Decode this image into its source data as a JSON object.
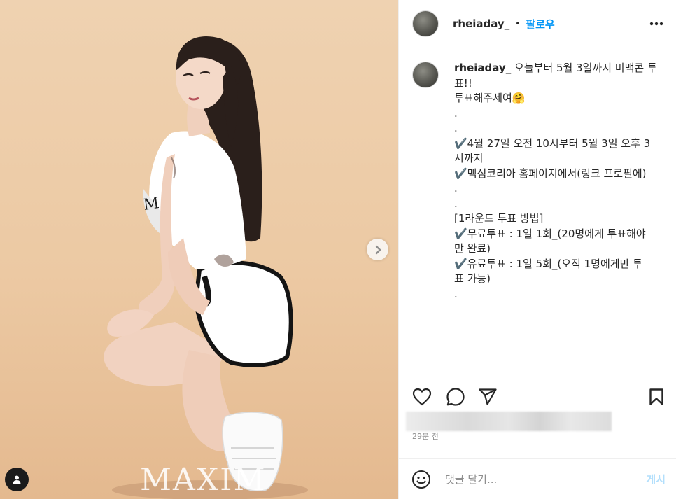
{
  "post": {
    "username": "rheiaday_",
    "dot": "•",
    "follow_label": "팔로우",
    "caption": " 오늘부터 5월 3일까지 미맥콘 투표!!\n투표해주세여🤗\n.\n.\n✔️4월 27일 오전 10시부터 5월 3일 오후 3\n시까지\n✔️맥심코리아 홈페이지에서(링크 프로필에)\n.\n.\n[1라운드 투표 방법]\n✔️무료투표 : 1일 1회_(20명에게 투표해야\n만 완료)\n✔️유료투표 : 1일 5회_(오직 1명에게만 투\n표 가능)\n.",
    "timestamp": "29분 전"
  },
  "media": {
    "watermark": "MAXIM",
    "bg_color": "#ecc9a3"
  },
  "icons": {
    "more": "more-horizontal-icon",
    "like": "heart-icon",
    "comment": "comment-bubble-icon",
    "share": "paper-plane-icon",
    "save": "bookmark-icon",
    "emoji": "emoji-smile-icon",
    "next": "chevron-right-icon",
    "tags": "user-tag-icon"
  },
  "comment_box": {
    "placeholder": "댓글 달기...",
    "post_label": "게시"
  },
  "colors": {
    "accent": "#0095f6",
    "post_disabled": "#b2dffc",
    "text": "#262626",
    "muted": "#8e8e8e"
  }
}
